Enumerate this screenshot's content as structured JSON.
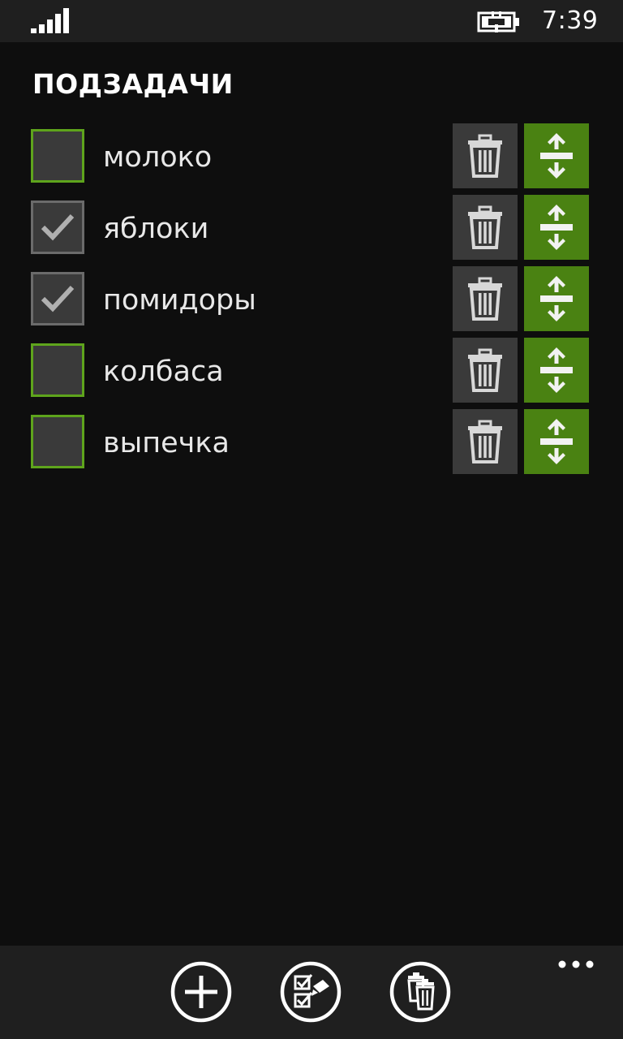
{
  "status_bar": {
    "time": "7:39",
    "icons": [
      "signal-strength-icon",
      "battery-charging-icon"
    ]
  },
  "header": {
    "title": "ПОДЗАДАЧИ"
  },
  "tasks": [
    {
      "label": "молоко",
      "checked": false
    },
    {
      "label": "яблоки",
      "checked": true
    },
    {
      "label": "помидоры",
      "checked": true
    },
    {
      "label": "колбаса",
      "checked": false
    },
    {
      "label": "выпечка",
      "checked": false
    }
  ],
  "row_icons": [
    "trash-icon",
    "reorder-icon"
  ],
  "app_bar": {
    "buttons": [
      "add-icon",
      "checklist-edit-icon",
      "delete-all-icon"
    ],
    "more": "more-dots-icon"
  },
  "colors": {
    "accent": "#4a8212",
    "checkbox_border": "#5ea41c",
    "background": "#0e0e0e",
    "bar": "#1f1f1f",
    "tile": "#3a3a3a"
  }
}
